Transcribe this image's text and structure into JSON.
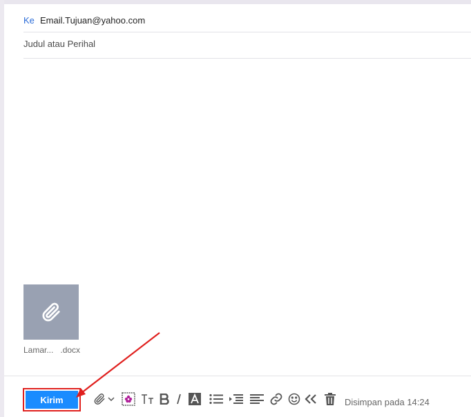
{
  "compose": {
    "to_label": "Ke",
    "to_value": "Email.Tujuan@yahoo.com",
    "subject_placeholder": "Judul atau Perihal",
    "attachment": {
      "name_start": "Lamar...",
      "name_end": ".docx",
      "icon": "paperclip-icon"
    }
  },
  "toolbar": {
    "send_label": "Kirim",
    "status": "Disimpan pada 14:24",
    "tools": [
      "attach-icon",
      "chevron-down-icon",
      "stationery-icon",
      "text-size-icon",
      "bold-icon",
      "italic-icon",
      "text-color-icon",
      "bullet-list-icon",
      "indent-icon",
      "align-icon",
      "link-icon",
      "emoji-icon",
      "rich-text-icon",
      "trash-icon"
    ]
  },
  "colors": {
    "accent": "#1a8cff",
    "highlight": "#e0201e",
    "to_label": "#2b6cd8",
    "attachment_bg": "#99a1b2"
  }
}
